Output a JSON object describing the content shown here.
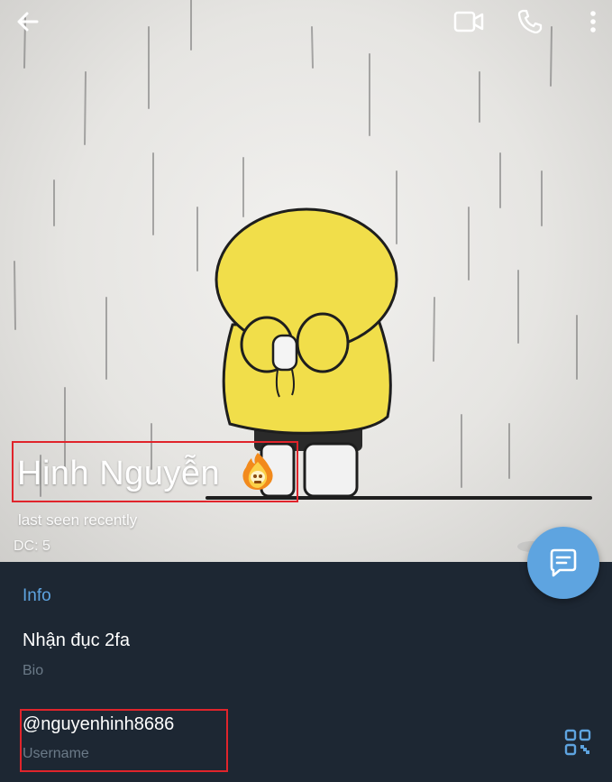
{
  "profile": {
    "name": "Hinh Nguyễn",
    "status": "last seen recently",
    "dc": "DC: 5"
  },
  "info": {
    "title": "Info",
    "bio_value": "Nhận đục 2fa",
    "bio_label": "Bio",
    "username_value": "@nguyenhinh8686",
    "username_label": "Username"
  },
  "icons": {
    "back": "arrow-left",
    "video": "video-camera",
    "call": "phone",
    "more": "three-dots-vertical",
    "fab": "message",
    "qr": "qr-code"
  },
  "colors": {
    "accent": "#5ea4e0",
    "panel_bg": "#1d2733",
    "highlight_box": "#e0242b"
  }
}
